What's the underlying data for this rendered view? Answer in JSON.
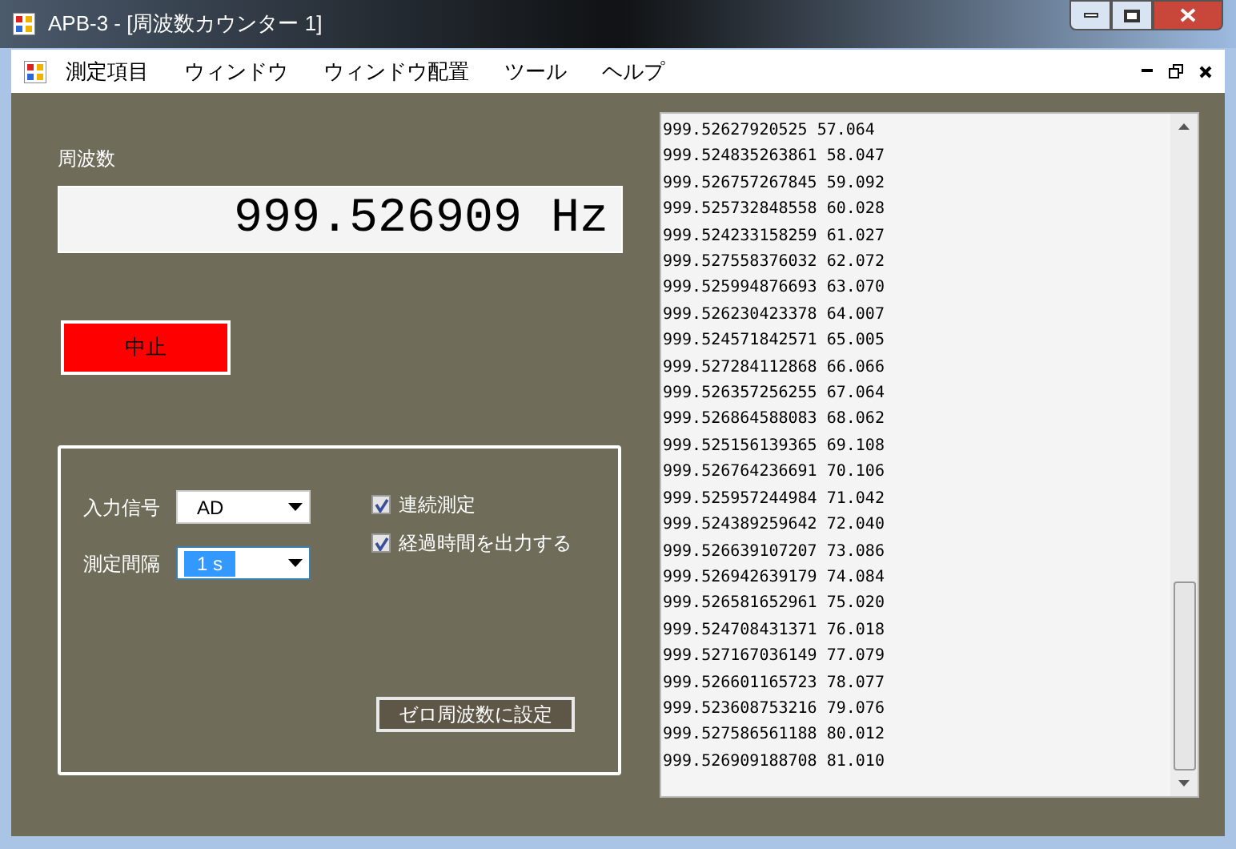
{
  "window": {
    "title": "APB-3 - [周波数カウンター 1]"
  },
  "menu": [
    "測定項目",
    "ウィンドウ",
    "ウィンドウ配置",
    "ツール",
    "ヘルプ"
  ],
  "frequency": {
    "label": "周波数",
    "value": "999.526909 Hz"
  },
  "stop_button": {
    "label": "中止",
    "color": "#ff0000"
  },
  "settings": {
    "input_signal": {
      "label": "入力信号",
      "value": "AD",
      "selected": false
    },
    "interval": {
      "label": "測定間隔",
      "value": "1 s",
      "selected": true
    },
    "checkboxes": [
      {
        "label": "連続測定",
        "checked": true
      },
      {
        "label": "経過時間を出力する",
        "checked": true
      }
    ],
    "zero_button": "ゼロ周波数に設定"
  },
  "log": [
    "999.52627920525 57.064",
    "999.524835263861 58.047",
    "999.526757267845 59.092",
    "999.525732848558 60.028",
    "999.524233158259 61.027",
    "999.527558376032 62.072",
    "999.525994876693 63.070",
    "999.526230423378 64.007",
    "999.524571842571 65.005",
    "999.527284112868 66.066",
    "999.526357256255 67.064",
    "999.526864588083 68.062",
    "999.525156139365 69.108",
    "999.526764236691 70.106",
    "999.525957244984 71.042",
    "999.524389259642 72.040",
    "999.526639107207 73.086",
    "999.526942639179 74.084",
    "999.526581652961 75.020",
    "999.524708431371 76.018",
    "999.527167036149 77.079",
    "999.526601165723 78.077",
    "999.523608753216 79.076",
    "999.527586561188 80.012",
    "999.526909188708 81.010"
  ]
}
